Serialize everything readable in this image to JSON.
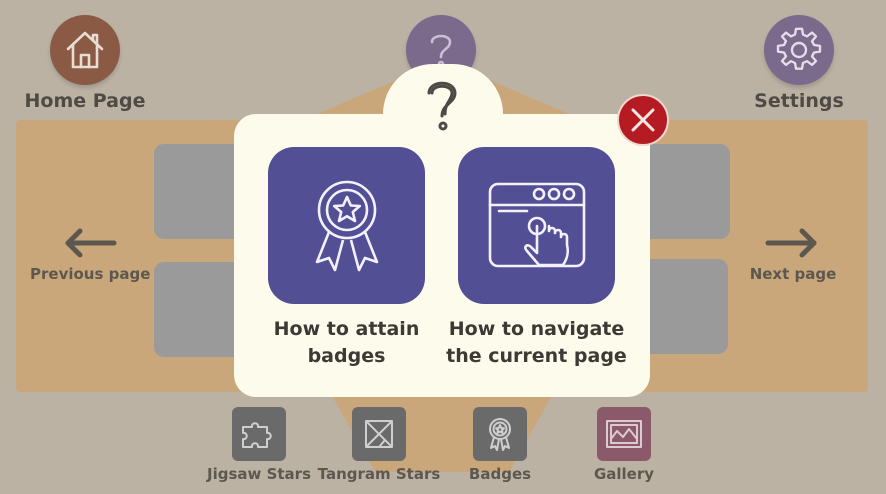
{
  "header": {
    "home_label": "Home Page",
    "settings_label": "Settings"
  },
  "nav": {
    "previous_label": "Previous page",
    "next_label": "Next page"
  },
  "bottom_bar": {
    "items": [
      {
        "label": "Jigsaw Stars",
        "icon": "puzzle-icon"
      },
      {
        "label": "Tangram Stars",
        "icon": "tangram-icon"
      },
      {
        "label": "Badges",
        "icon": "badge-icon"
      },
      {
        "label": "Gallery",
        "icon": "gallery-icon"
      }
    ]
  },
  "help_modal": {
    "icon": "question-mark-icon",
    "options": [
      {
        "label_line1": "How to attain",
        "label_line2": "badges",
        "icon": "badge-ribbon-icon"
      },
      {
        "label_line1": "How to navigate",
        "label_line2": "the current page",
        "icon": "browser-click-icon"
      }
    ],
    "close_icon": "close-icon"
  },
  "colors": {
    "overlay_bg": "#bcb2a4",
    "home_button": "#8a5a45",
    "help_button": "#7b6a8c",
    "settings_button": "#7b6a8c",
    "tile_purple": "#534f95",
    "modal_bg": "#fdfbec",
    "close_red": "#b51b22",
    "gallery_tile": "#8a5a6a"
  }
}
